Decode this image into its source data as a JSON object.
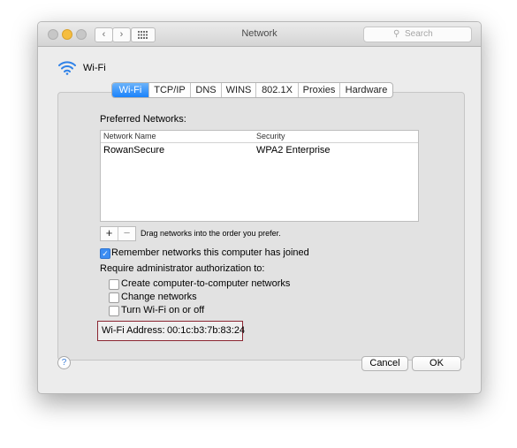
{
  "window": {
    "title": "Network"
  },
  "search": {
    "placeholder": "Search",
    "icon": "search-icon"
  },
  "toolbar": {
    "back_glyph": "‹",
    "forward_glyph": "›",
    "show_all_icon": "grid-icon"
  },
  "device": {
    "name": "Wi-Fi",
    "icon": "wifi-icon"
  },
  "tabs": [
    {
      "label": "Wi-Fi",
      "active": true
    },
    {
      "label": "TCP/IP"
    },
    {
      "label": "DNS"
    },
    {
      "label": "WINS"
    },
    {
      "label": "802.1X"
    },
    {
      "label": "Proxies"
    },
    {
      "label": "Hardware"
    }
  ],
  "preferred": {
    "title": "Preferred Networks:",
    "columns": [
      "Network Name",
      "Security"
    ],
    "rows": [
      {
        "name": "RowanSecure",
        "security": "WPA2 Enterprise"
      }
    ],
    "add_glyph": "+",
    "remove_glyph": "−",
    "hint": "Drag networks into the order you prefer."
  },
  "remember": {
    "label": "Remember networks this computer has joined",
    "checked": true
  },
  "admin": {
    "title": "Require administrator authorization to:",
    "options": [
      {
        "label": "Create computer-to-computer networks",
        "checked": false
      },
      {
        "label": "Change networks",
        "checked": false
      },
      {
        "label": "Turn Wi-Fi on or off",
        "checked": false
      }
    ]
  },
  "address": {
    "label": "Wi-Fi Address:",
    "value": "00:1c:b3:7b:83:24"
  },
  "footer": {
    "help_glyph": "?",
    "cancel_label": "Cancel",
    "ok_label": "OK"
  },
  "colors": {
    "accent": "#1a82fb",
    "highlight_border": "#8b2632",
    "minimize": "#f5bd3f"
  }
}
